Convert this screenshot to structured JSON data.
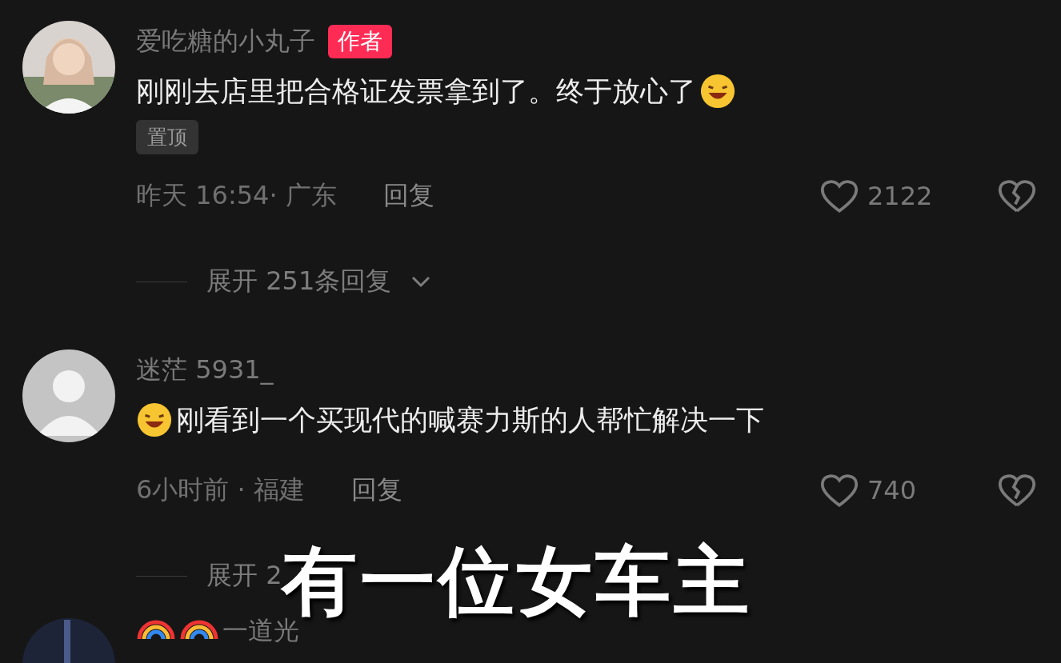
{
  "comments": [
    {
      "author": "爱吃糖的小丸子",
      "badge": "作者",
      "text": "刚刚去店里把合格证发票拿到了。终于放心了",
      "kind": "trailing",
      "pinned": "置顶",
      "meta": "昨天 16:54· 广东",
      "reply": "回复",
      "likes": "2122",
      "expand": "展开 251条回复"
    },
    {
      "author": "迷茫 5931_",
      "avatar": {
        "kind": "default"
      },
      "text": "刚看到一个买现代的喊赛力斯的人帮忙解决一下",
      "kind": "leading",
      "meta": "6小时前 · 福建",
      "reply": "回复",
      "likes": "740",
      "expand": "展开 2"
    }
  ],
  "partial_comment": {
    "author": "一道光"
  },
  "subtitle": "有一位女车主"
}
